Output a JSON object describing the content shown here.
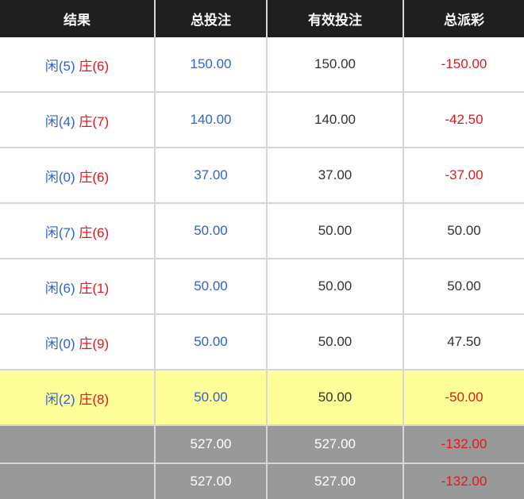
{
  "headers": [
    "结果",
    "总投注",
    "有效投注",
    "总派彩"
  ],
  "colors": {
    "blue": "#2b63d9",
    "red": "#e8141b",
    "highlight": "#ffff99",
    "header_bg": "#1f1f1f",
    "total_bg": "#999999"
  },
  "rows": [
    {
      "player": "闲(5)",
      "banker": "庄(6)",
      "total_bet": "150.00",
      "valid_bet": "150.00",
      "payout": "-150.00",
      "payout_negative": true,
      "highlight": false
    },
    {
      "player": "闲(4)",
      "banker": "庄(7)",
      "total_bet": "140.00",
      "valid_bet": "140.00",
      "payout": "-42.50",
      "payout_negative": true,
      "highlight": false
    },
    {
      "player": "闲(0)",
      "banker": "庄(6)",
      "total_bet": "37.00",
      "valid_bet": "37.00",
      "payout": "-37.00",
      "payout_negative": true,
      "highlight": false
    },
    {
      "player": "闲(7)",
      "banker": "庄(6)",
      "total_bet": "50.00",
      "valid_bet": "50.00",
      "payout": "50.00",
      "payout_negative": false,
      "highlight": false
    },
    {
      "player": "闲(6)",
      "banker": "庄(1)",
      "total_bet": "50.00",
      "valid_bet": "50.00",
      "payout": "50.00",
      "payout_negative": false,
      "highlight": false
    },
    {
      "player": "闲(0)",
      "banker": "庄(9)",
      "total_bet": "50.00",
      "valid_bet": "50.00",
      "payout": "47.50",
      "payout_negative": false,
      "highlight": false
    },
    {
      "player": "闲(2)",
      "banker": "庄(8)",
      "total_bet": "50.00",
      "valid_bet": "50.00",
      "payout": "-50.00",
      "payout_negative": true,
      "highlight": true
    }
  ],
  "totals": [
    {
      "label": "",
      "total_bet": "527.00",
      "valid_bet": "527.00",
      "payout": "-132.00"
    },
    {
      "label": "",
      "total_bet": "527.00",
      "valid_bet": "527.00",
      "payout": "-132.00"
    }
  ]
}
